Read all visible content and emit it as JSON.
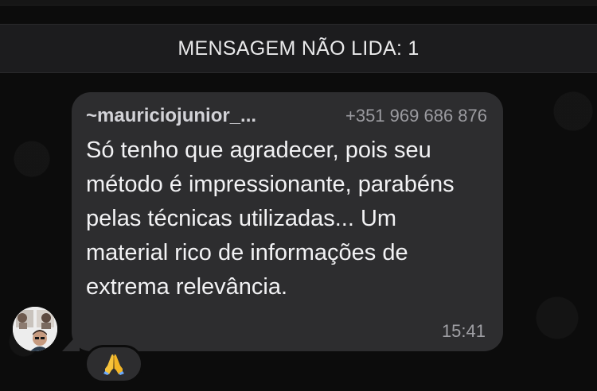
{
  "banner": {
    "unread_label": "MENSAGEM NÃO LIDA: 1"
  },
  "message": {
    "sender_name": "~mauriciojunior_...",
    "sender_phone": "+351 969 686 876",
    "text": "Só tenho que agradecer, pois seu método é impressionante, parabéns pelas técnicas utilizadas... Um material rico de informações de extrema relevância.",
    "time": "15:41"
  },
  "reaction": {
    "icon": "folded-hands-icon"
  },
  "colors": {
    "background": "#0c0c0c",
    "banner": "#1c1c1e",
    "bubble": "#2d2d2f",
    "message_text": "#f2f2f4",
    "sender_name": "#d3d3d8",
    "meta_text": "#9b9ba0"
  }
}
